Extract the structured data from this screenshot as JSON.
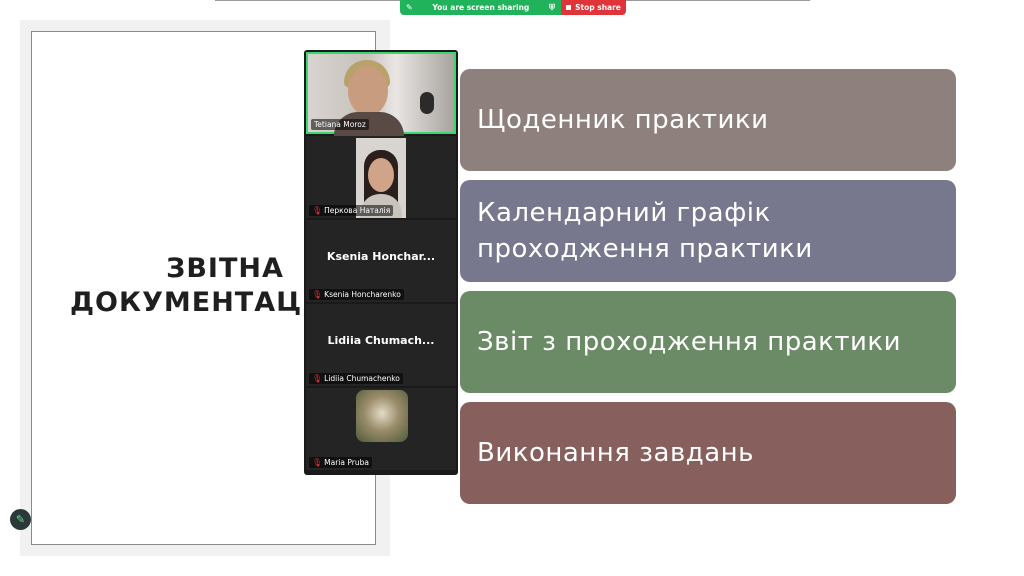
{
  "share_bar": {
    "sharing_label": "You are screen sharing",
    "stop_label": "Stop share",
    "colors": {
      "sharing_bg": "#20b35b",
      "stop_bg": "#e0343b"
    }
  },
  "slide": {
    "title_line1": "ЗВІТНА",
    "title_line2": "ДОКУМЕНТАЦ",
    "items": [
      {
        "text": "Щоденник практики",
        "color": "#8e807c"
      },
      {
        "text": "Календарний графік проходження практики",
        "color": "#77778d"
      },
      {
        "text": "Звіт з проходження практики",
        "color": "#6b8a66"
      },
      {
        "text": "Виконання завдань",
        "color": "#875f5c"
      }
    ]
  },
  "participants": [
    {
      "name": "Tetiana Moroz",
      "video": "camera",
      "muted": false,
      "active": true
    },
    {
      "name": "Перкова Наталія",
      "video": "camera",
      "muted": true,
      "active": false
    },
    {
      "name": "Ksenia Honcharenko",
      "display_name": "Ksenia  Honchar...",
      "video": "off",
      "muted": true,
      "active": false
    },
    {
      "name": "Lidiia Chumachenko",
      "display_name": "Lidiia  Chumach...",
      "video": "off",
      "muted": true,
      "active": false
    },
    {
      "name": "Maria Pruba",
      "video": "avatar",
      "muted": true,
      "active": false
    }
  ],
  "icons": {
    "mic_off": "mic-off-icon",
    "pen": "pen-icon",
    "shield": "shield-icon",
    "share": "share-icon"
  }
}
